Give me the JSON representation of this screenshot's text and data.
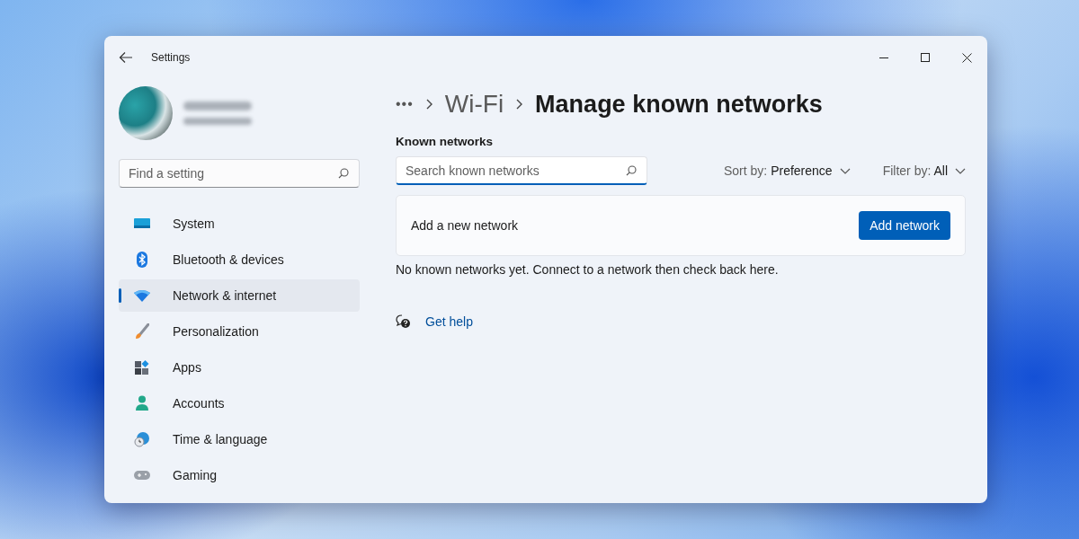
{
  "window": {
    "title": "Settings"
  },
  "sidebar": {
    "search": {
      "placeholder": "Find a setting"
    },
    "items": [
      {
        "label": "System",
        "selected": false
      },
      {
        "label": "Bluetooth & devices",
        "selected": false
      },
      {
        "label": "Network & internet",
        "selected": true
      },
      {
        "label": "Personalization",
        "selected": false
      },
      {
        "label": "Apps",
        "selected": false
      },
      {
        "label": "Accounts",
        "selected": false
      },
      {
        "label": "Time & language",
        "selected": false
      },
      {
        "label": "Gaming",
        "selected": false
      }
    ]
  },
  "breadcrumb": [
    "•••",
    "Wi-Fi",
    "Manage known networks"
  ],
  "section_title": "Known networks",
  "search": {
    "placeholder": "Search known networks",
    "focused": true
  },
  "sort": {
    "label": "Sort by:",
    "value": "Preference"
  },
  "filter": {
    "label": "Filter by:",
    "value": "All"
  },
  "add_card": {
    "label": "Add a new network",
    "button": "Add network"
  },
  "empty_message": "No known networks yet. Connect to a network then check back here.",
  "help_link": "Get help"
}
